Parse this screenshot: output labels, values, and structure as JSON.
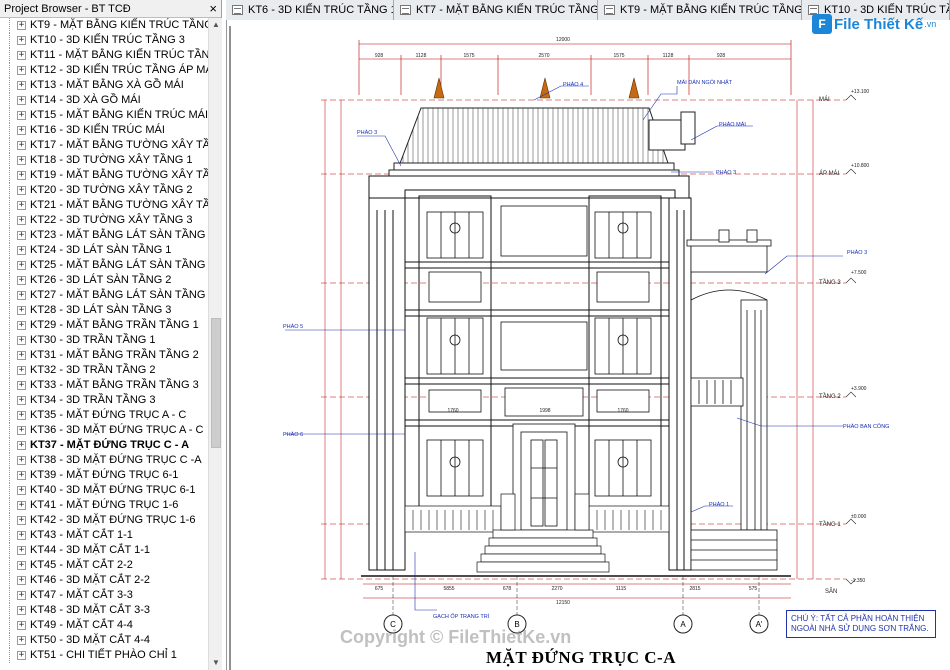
{
  "browser": {
    "title": "Project Browser - BT TCĐ",
    "close_glyph": "×",
    "items": [
      {
        "label": "KT9 - MẶT BẰNG KIẾN TRÚC TẦNG 3",
        "selected": false
      },
      {
        "label": "KT10 - 3D KIẾN TRÚC TẦNG 3",
        "selected": false
      },
      {
        "label": "KT11 - MẶT BẰNG KIẾN TRÚC TẦNG ÁP",
        "selected": false
      },
      {
        "label": "KT12 - 3D KIẾN TRÚC TẦNG ÁP MÁI",
        "selected": false
      },
      {
        "label": "KT13 - MẶT BẰNG XÀ GỒ MÁI",
        "selected": false
      },
      {
        "label": "KT14 - 3D XÀ GỒ MÁI",
        "selected": false
      },
      {
        "label": "KT15 - MẶT BẰNG KIẾN TRÚC MÁI",
        "selected": false
      },
      {
        "label": "KT16 - 3D KIẾN TRÚC MÁI",
        "selected": false
      },
      {
        "label": "KT17 - MẶT BẰNG TƯỜNG XÂY TẦNG 1",
        "selected": false
      },
      {
        "label": "KT18 - 3D TƯỜNG XÂY TẦNG 1",
        "selected": false
      },
      {
        "label": "KT19 - MẶT BẰNG TƯỜNG XÂY TẦNG 2",
        "selected": false
      },
      {
        "label": "KT20 - 3D TƯỜNG XÂY TẦNG 2",
        "selected": false
      },
      {
        "label": "KT21 - MẶT BẰNG TƯỜNG XÂY TẦNG 3",
        "selected": false
      },
      {
        "label": "KT22 - 3D TƯỜNG XÂY TẦNG 3",
        "selected": false
      },
      {
        "label": "KT23 - MẶT BẰNG LÁT SÀN TẦNG 1",
        "selected": false
      },
      {
        "label": "KT24 - 3D LÁT SÀN TẦNG 1",
        "selected": false
      },
      {
        "label": "KT25 - MẶT BẰNG LÁT SÀN TẦNG 2",
        "selected": false
      },
      {
        "label": "KT26 - 3D LÁT SÀN TẦNG 2",
        "selected": false
      },
      {
        "label": "KT27 - MẶT BẰNG LÁT SÀN TẦNG 3",
        "selected": false
      },
      {
        "label": "KT28 - 3D LÁT SÀN TẦNG 3",
        "selected": false
      },
      {
        "label": "KT29 - MẶT BẰNG TRẦN TẦNG 1",
        "selected": false
      },
      {
        "label": "KT30 - 3D TRẦN TẦNG 1",
        "selected": false
      },
      {
        "label": "KT31 - MẶT BẰNG TRẦN TẦNG 2",
        "selected": false
      },
      {
        "label": "KT32 - 3D TRẦN TẦNG 2",
        "selected": false
      },
      {
        "label": "KT33 - MẶT BẰNG TRẦN TẦNG 3",
        "selected": false
      },
      {
        "label": "KT34 - 3D TRẦN TẦNG 3",
        "selected": false
      },
      {
        "label": "KT35 - MẶT ĐỨNG TRỤC A - C",
        "selected": false
      },
      {
        "label": "KT36 - 3D MẶT ĐỨNG TRỤC A - C",
        "selected": false
      },
      {
        "label": "KT37 - MẶT ĐỨNG TRỤC C - A",
        "selected": true
      },
      {
        "label": "KT38 - 3D MẶT ĐỨNG TRỤC C -A",
        "selected": false
      },
      {
        "label": "KT39 - MẶT ĐỨNG TRỤC 6-1",
        "selected": false
      },
      {
        "label": "KT40 - 3D MẶT ĐỨNG TRỤC 6-1",
        "selected": false
      },
      {
        "label": "KT41 - MẶT ĐỨNG TRỤC 1-6",
        "selected": false
      },
      {
        "label": "KT42 - 3D MẶT ĐỨNG TRỤC 1-6",
        "selected": false
      },
      {
        "label": "KT43 - MẶT CẮT 1-1",
        "selected": false
      },
      {
        "label": "KT44 - 3D MẶT CẮT 1-1",
        "selected": false
      },
      {
        "label": "KT45 - MẶT CẮT 2-2",
        "selected": false
      },
      {
        "label": "KT46 - 3D MẶT CẮT 2-2",
        "selected": false
      },
      {
        "label": "KT47 - MẶT CẮT 3-3",
        "selected": false
      },
      {
        "label": "KT48 - 3D MẶT CẮT 3-3",
        "selected": false
      },
      {
        "label": "KT49 - MẶT CẮT 4-4",
        "selected": false
      },
      {
        "label": "KT50 - 3D MẶT CẮT 4-4",
        "selected": false
      },
      {
        "label": "KT51 - CHI TIẾT PHÀO CHỈ 1",
        "selected": false
      }
    ]
  },
  "tabs": [
    {
      "label": "KT6 - 3D KIẾN TRÚC TẦNG 1"
    },
    {
      "label": "KT7 - MẶT BẰNG KIẾN TRÚC TẦNG 2"
    },
    {
      "label": "KT9 - MẶT BẰNG KIẾN TRÚC TẦNG 3"
    },
    {
      "label": "KT10 - 3D KIẾN TRÚC TẦNG 3"
    }
  ],
  "logo": {
    "mark": "F",
    "text": "File Thiết Kế",
    "suffix": ".vn"
  },
  "watermark": "Copyright © FileThietKe.vn",
  "drawing": {
    "title": "MẶT ĐỨNG TRỤC C-A",
    "note": "CHÚ Ý: TẤT CẢ PHẦN HOÀN THIỆN NGOÀI NHÀ SỬ DỤNG SƠN TRẮNG.",
    "levels": [
      {
        "name": "MÁI",
        "elev": "+13.100"
      },
      {
        "name": "ÁP MÁI",
        "elev": "+10.800"
      },
      {
        "name": "TẦNG 3",
        "elev": "+7.500"
      },
      {
        "name": "TẦNG 2",
        "elev": "+3.900"
      },
      {
        "name": "TẦNG 1",
        "elev": "±0.000"
      },
      {
        "name": "SÂN",
        "elev": "-1.350"
      }
    ],
    "callouts": {
      "phao4": "PHÀO 4",
      "mai_ngoi": "MÁI DÁN NGÓI NHẬT",
      "phao_mai": "PHÀO MÁI",
      "phao3_left": "PHÀO 3",
      "phao3_mid": "PHÀO 3",
      "phao3_right": "PHÀO 3",
      "phao5": "PHÀO 5",
      "phao6": "PHÀO 6",
      "phao1": "PHÀO 1",
      "phao_ban_cong": "PHÀO BAN CÔNG",
      "gach_op": "GẠCH ỐP TRANG TRÍ"
    },
    "top_dims": [
      "928",
      "1128",
      "1575",
      "2570",
      "1575",
      "1128",
      "928"
    ],
    "top_total": "12000",
    "bottom_dims": [
      "675",
      "5855",
      "678",
      "2270",
      "1115",
      "2815",
      "575"
    ],
    "bottom_total": "12150",
    "mid_dims": [
      "1760",
      "1998",
      "1760"
    ],
    "axes": [
      "C",
      "B",
      "A",
      "A'"
    ]
  }
}
